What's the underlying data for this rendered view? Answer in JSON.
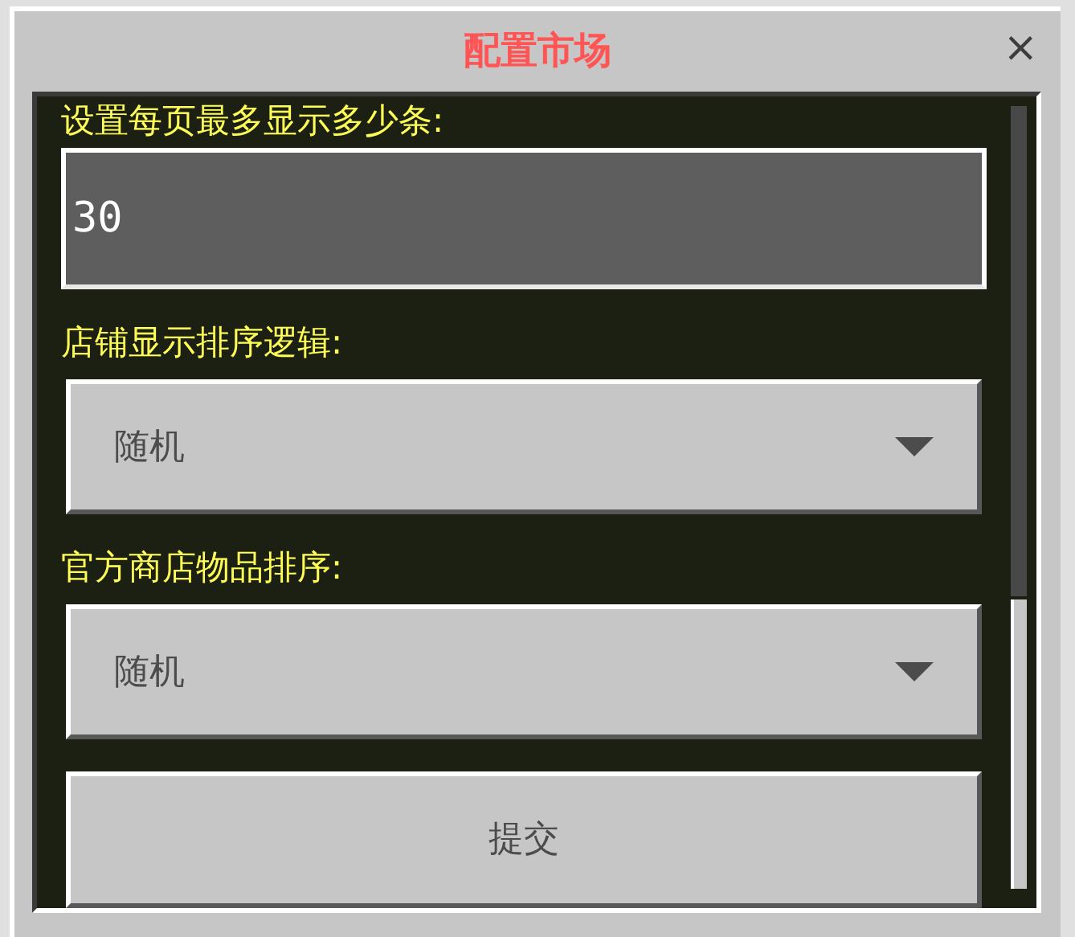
{
  "window": {
    "title": "配置市场",
    "close": "×"
  },
  "fields": [
    {
      "kind": "input",
      "label": "设置每页最多显示多少条:",
      "value": "30"
    },
    {
      "kind": "dropdown",
      "label": "店铺显示排序逻辑:",
      "value": "随机"
    },
    {
      "kind": "dropdown",
      "label": "官方商店物品排序:",
      "value": "随机"
    }
  ],
  "submit": "提交"
}
